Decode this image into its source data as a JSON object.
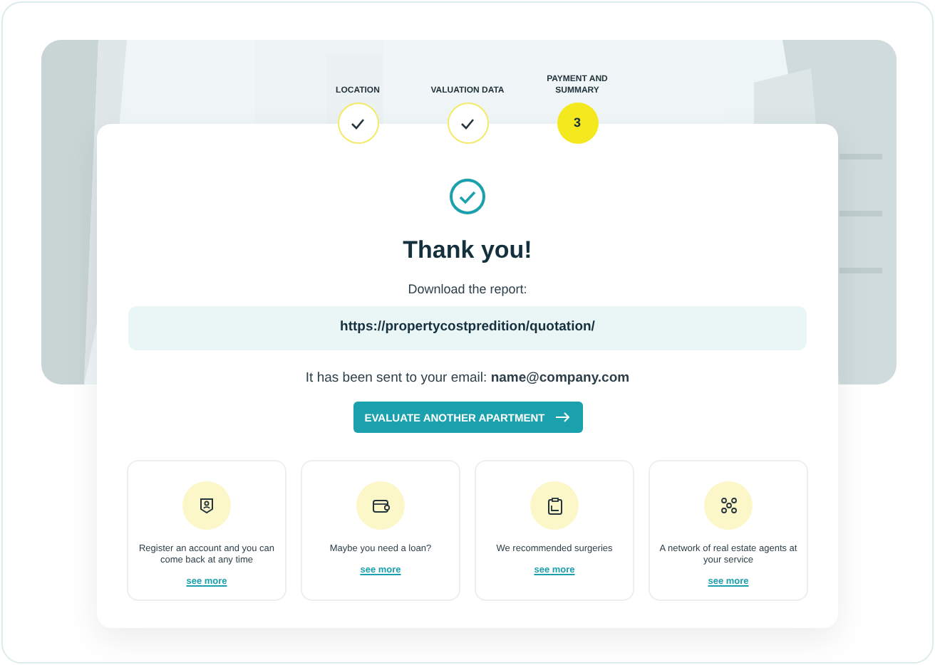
{
  "steps": [
    {
      "label": "LOCATION",
      "completed": true
    },
    {
      "label": "VALUATION DATA",
      "completed": true
    },
    {
      "label": "PAYMENT AND SUMMARY",
      "completed": false,
      "number": "3"
    }
  ],
  "result": {
    "title": "Thank you!",
    "download_label": "Download the report:",
    "report_url": "https://propertycostpredition/quotation/",
    "email_note": "It has been sent to your email: **name@company.com**",
    "button": "EVALUATE ANOTHER APARTMENT"
  },
  "features": [
    {
      "kind": "account",
      "text": "Register an account and you can come back at any time",
      "link": "see more"
    },
    {
      "kind": "loan",
      "text": "Maybe you need a loan?",
      "link": "see more"
    },
    {
      "kind": "clipboard",
      "text": "We recommended surgeries",
      "link": "see more"
    },
    {
      "kind": "network",
      "text": "A network of real estate agents at your service",
      "link": "see more"
    }
  ]
}
